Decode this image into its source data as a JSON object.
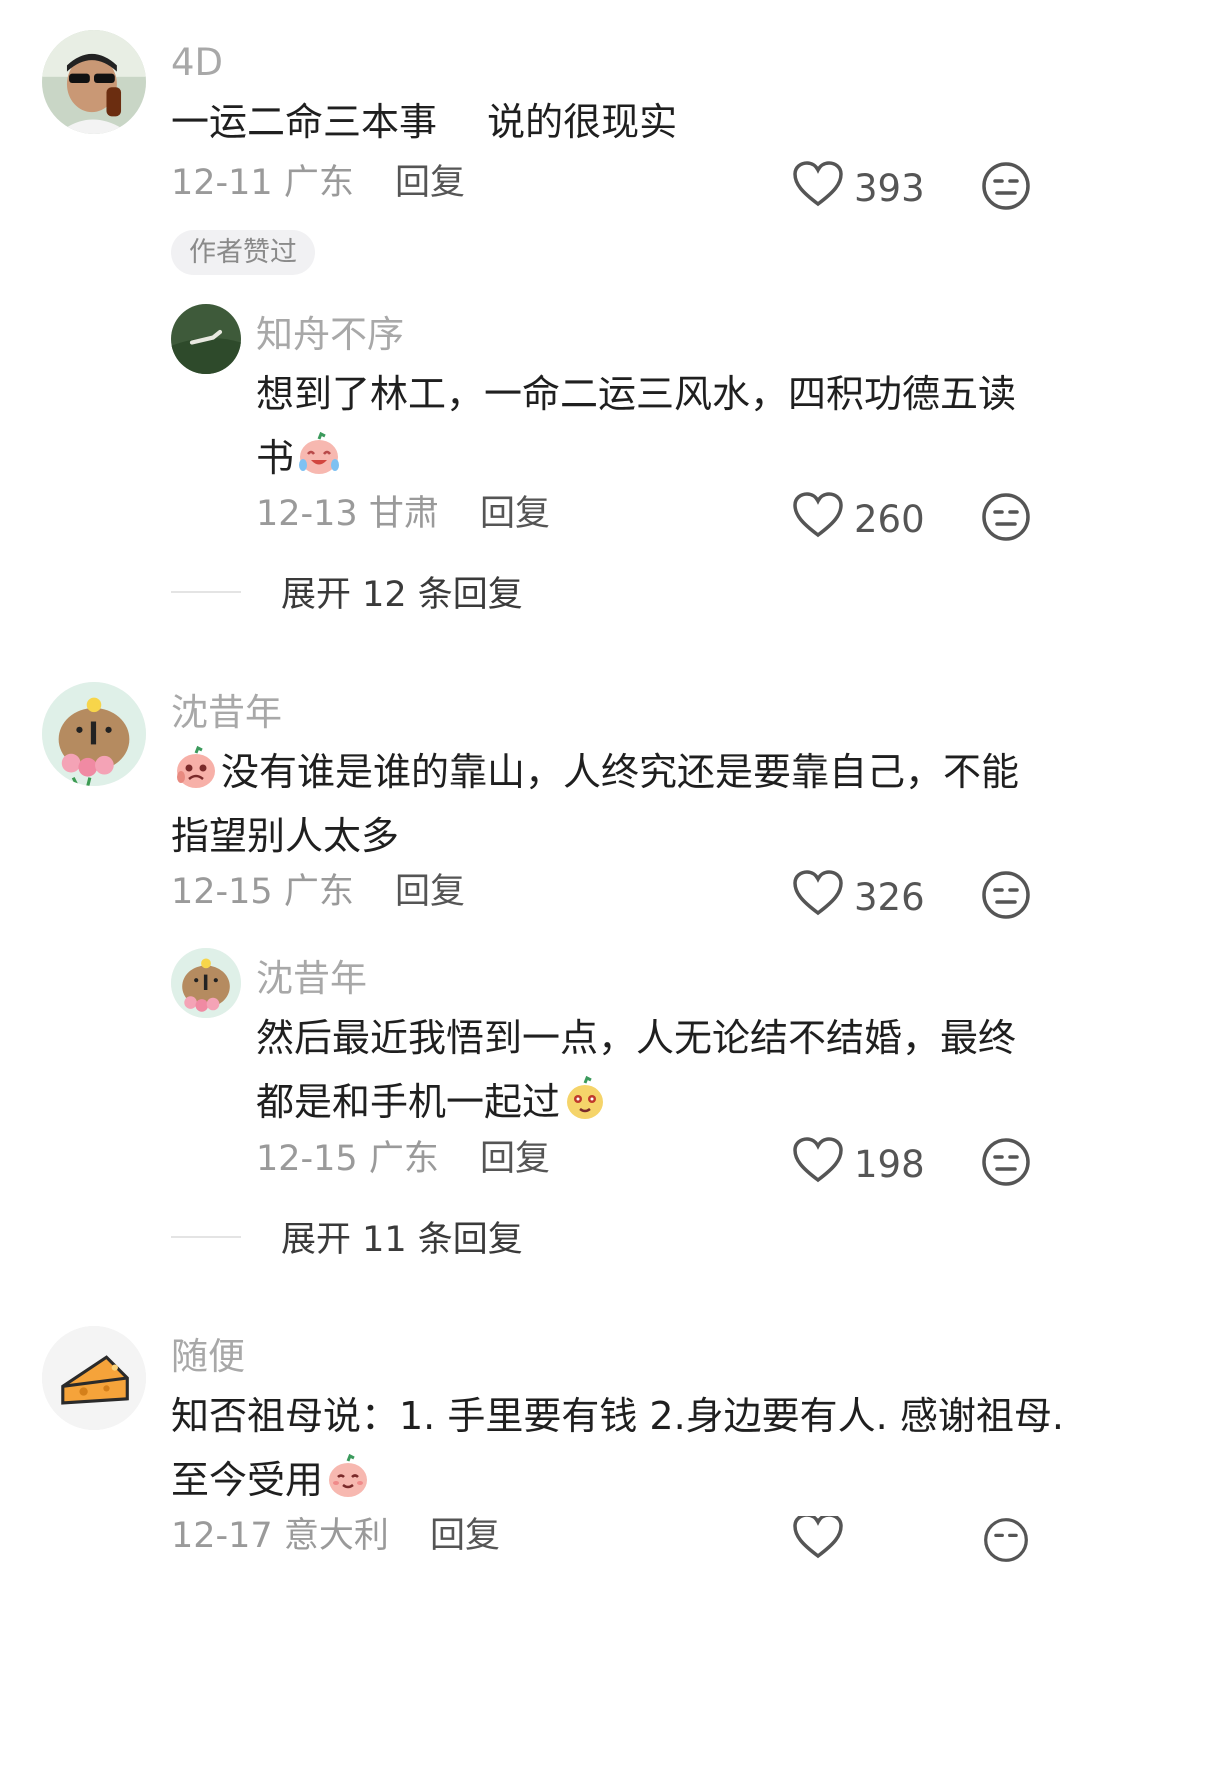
{
  "comments": [
    {
      "user": "4D",
      "text": "一运二命三本事　 说的很现实",
      "date": "12-11",
      "location": "广东",
      "reply": "回复",
      "likes": "393",
      "badge": "作者赞过",
      "sub": {
        "user": "知舟不序",
        "text_line1": "想到了林工，一命二运三风水，四积功德五读",
        "text_line2": "书",
        "date": "12-13",
        "location": "甘肃",
        "reply": "回复",
        "likes": "260"
      },
      "expand": "展开 12 条回复"
    },
    {
      "user": "沈昔年",
      "text_line1": "没有谁是谁的靠山，人终究还是要靠自己，不能",
      "text_line2": "指望别人太多",
      "date": "12-15",
      "location": "广东",
      "reply": "回复",
      "likes": "326",
      "sub": {
        "user": "沈昔年",
        "text_line1": "然后最近我悟到一点，人无论结不结婚，最终",
        "text_line2": "都是和手机一起过",
        "date": "12-15",
        "location": "广东",
        "reply": "回复",
        "likes": "198"
      },
      "expand": "展开 11 条回复"
    },
    {
      "user": "随便",
      "text_line1": "知否祖母说：1. 手里要有钱 2.身边要有人. 感谢祖母.",
      "text_line2": "至今受用",
      "date": "12-17",
      "location": "意大利",
      "reply": "回复"
    }
  ],
  "icons": {
    "like": "heart-outline-icon",
    "dislike": "meh-face-icon"
  }
}
